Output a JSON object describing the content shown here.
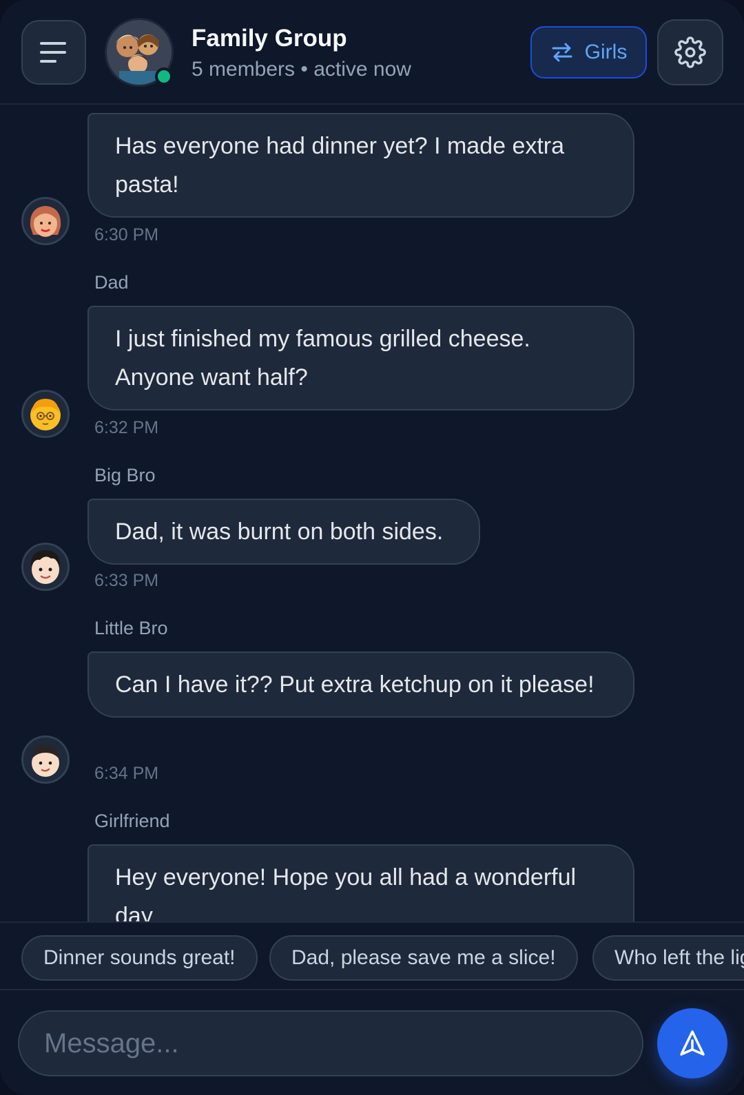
{
  "header": {
    "title": "Family Group",
    "subtitle": "5 members • active now",
    "switch_label": "Girls",
    "menu_icon": "menu-icon",
    "switch_icon": "swap-icon",
    "settings_icon": "gear-icon"
  },
  "messages": [
    {
      "sender": "",
      "text": "Has everyone had dinner yet? I made extra pasta!",
      "time": "6:30 PM",
      "avatar": "mom-avatar"
    },
    {
      "sender": "Dad",
      "text": "I just finished my famous grilled cheese. Anyone want half?",
      "time": "6:32 PM",
      "avatar": "dad-avatar"
    },
    {
      "sender": "Big Bro",
      "text": "Dad, it was burnt on both sides.",
      "time": "6:33 PM",
      "avatar": "big-bro-avatar"
    },
    {
      "sender": "Little Bro",
      "text": "Can I have it?? Put extra ketchup on it please!",
      "time": "6:34 PM",
      "avatar": "little-bro-avatar"
    },
    {
      "sender": "Girlfriend",
      "text": "Hey everyone! Hope you all had a wonderful day",
      "time": "",
      "avatar": ""
    }
  ],
  "quick_replies": [
    "Dinner sounds great!",
    "Dad, please save me a slice!",
    "Who left the lig"
  ],
  "composer": {
    "placeholder": "Message...",
    "send_icon": "send-icon"
  },
  "colors": {
    "background": "#0f172a",
    "bubble": "#1e293b",
    "accent": "#2563eb",
    "online": "#10b981"
  }
}
